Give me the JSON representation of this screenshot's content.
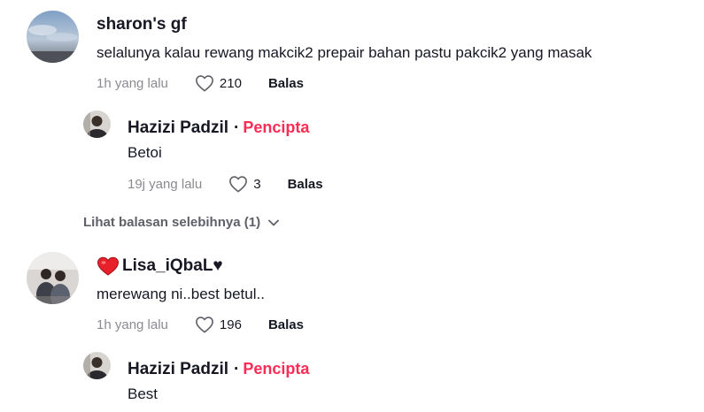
{
  "comments": [
    {
      "author": "sharon's gf",
      "text": "selalunya kalau rewang makcik2 prepair bahan pastu pakcik2 yang masak",
      "time": "1h yang lalu",
      "likes": "210",
      "reply_label": "Balas",
      "replies": [
        {
          "author": "Hazizi Padzil",
          "separator": "·",
          "badge": "Pencipta",
          "text": "Betoi",
          "time": "19j yang lalu",
          "likes": "3",
          "reply_label": "Balas"
        }
      ],
      "more_replies": "Lihat balasan selebihnya (1)"
    },
    {
      "author_icon": "red-heart-emoji",
      "author": "Lisa_iQbaL♥",
      "text": "merewang ni..best betul..",
      "time": "1h yang lalu",
      "likes": "196",
      "reply_label": "Balas",
      "replies": [
        {
          "author": "Hazizi Padzil",
          "separator": "·",
          "badge": "Pencipta",
          "text": "Best"
        }
      ]
    }
  ],
  "colors": {
    "creator_badge": "#fe2c55",
    "secondary_text": "#8a8b91",
    "heart_emoji": "#e8202a"
  },
  "icons": [
    "heart-outline-icon",
    "chevron-down-icon",
    "red-heart-emoji"
  ]
}
